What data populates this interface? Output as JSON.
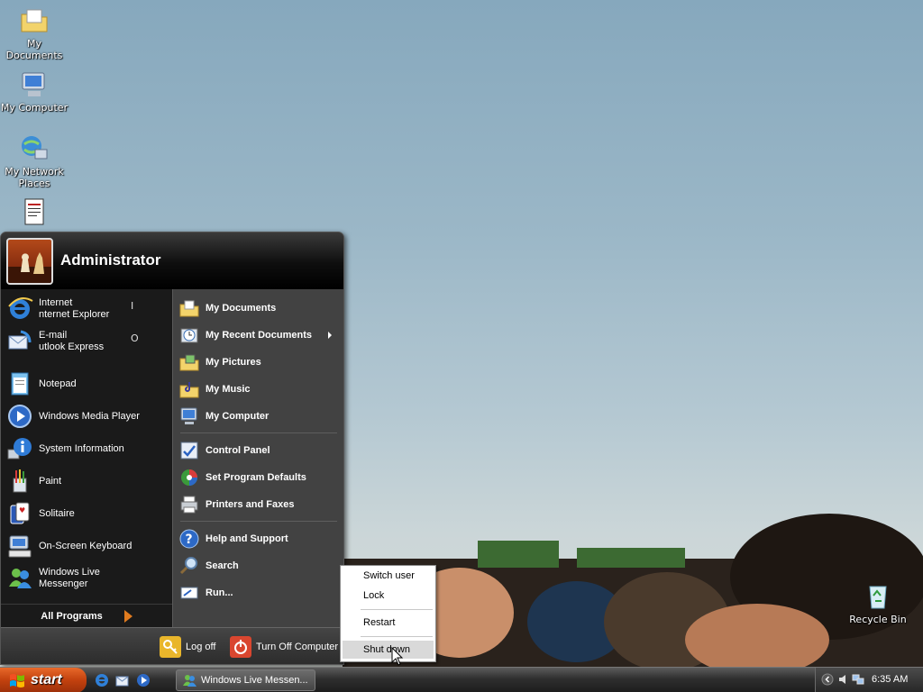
{
  "desktop": {
    "icons": [
      {
        "label": "My Documents",
        "icon": "folder-documents-icon"
      },
      {
        "label": "My Computer",
        "icon": "computer-icon"
      },
      {
        "label": "My Network Places",
        "icon": "network-places-icon"
      },
      {
        "label": "",
        "icon": "document-icon"
      },
      {
        "label": "Recycle Bin",
        "icon": "recycle-bin-icon"
      }
    ]
  },
  "start_menu": {
    "user_name": "Administrator",
    "left_items": [
      {
        "label": "Internet\nnternet Explorer",
        "hotkey": "I",
        "icon": "internet-explorer-icon"
      },
      {
        "label": "E-mail\nutlook Express",
        "hotkey": "O",
        "icon": "outlook-express-icon"
      },
      {
        "label": "Notepad",
        "icon": "notepad-icon"
      },
      {
        "label": "Windows Media Player",
        "icon": "media-player-icon"
      },
      {
        "label": "System Information",
        "icon": "system-information-icon"
      },
      {
        "label": "Paint",
        "icon": "paint-icon"
      },
      {
        "label": "Solitaire",
        "icon": "solitaire-icon"
      },
      {
        "label": "On-Screen Keyboard",
        "icon": "keyboard-icon"
      },
      {
        "label": "Windows Live\nMessenger",
        "icon": "messenger-icon"
      }
    ],
    "all_programs": "All Programs",
    "right_items": [
      {
        "label": "My Documents",
        "icon": "folder-documents-icon"
      },
      {
        "label": "My Recent Documents",
        "icon": "recent-documents-icon"
      },
      {
        "label": "My Pictures",
        "icon": "folder-pictures-icon"
      },
      {
        "label": "My Music",
        "icon": "folder-music-icon"
      },
      {
        "label": "My Computer",
        "icon": "computer-icon"
      },
      {
        "label": "Control Panel",
        "icon": "control-panel-icon"
      },
      {
        "label": "Set Program Defaults",
        "icon": "program-defaults-icon"
      },
      {
        "label": "Printers and Faxes",
        "icon": "printer-icon"
      },
      {
        "label": "Help and Support",
        "icon": "help-icon"
      },
      {
        "label": "Search",
        "icon": "search-icon"
      },
      {
        "label": "Run...",
        "icon": "run-icon"
      }
    ],
    "footer": {
      "log_off": "Log off",
      "turn_off": "Turn Off Computer"
    }
  },
  "context_menu": {
    "items": [
      "Switch user",
      "Lock",
      "Restart",
      "Shut down"
    ],
    "highlighted": "Shut down"
  },
  "taskbar": {
    "start_label": "start",
    "task_label": "Windows Live Messen...",
    "clock": "6:35 AM"
  },
  "colors": {
    "start_button": "#c2410e",
    "menu_dark": "#1a1a1a",
    "menu_right": "#424242",
    "highlight": "#d9d9d9"
  }
}
